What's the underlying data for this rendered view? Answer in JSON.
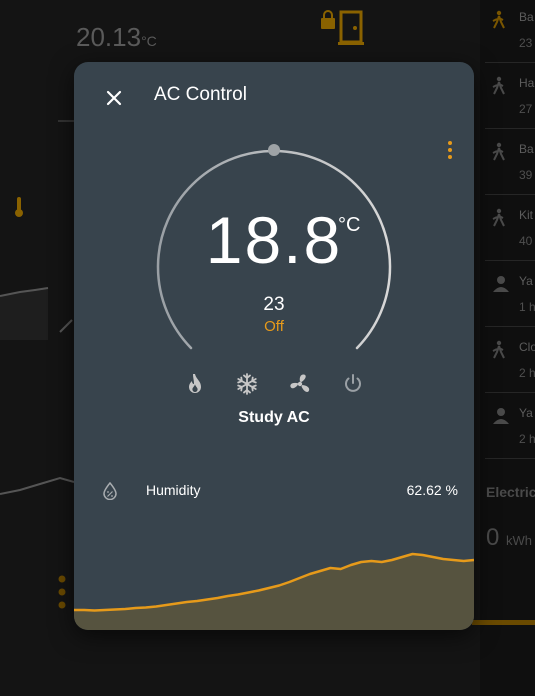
{
  "background": {
    "temperature": "20.13",
    "temperature_unit": "°C",
    "right_rows": [
      {
        "label": "Ba",
        "value": "23"
      },
      {
        "label": "Ha",
        "value": "27"
      },
      {
        "label": "Ba",
        "value": "39"
      },
      {
        "label": "Kit",
        "value": "40"
      },
      {
        "label": "Ya",
        "value": "1 h"
      },
      {
        "label": "Clo",
        "value": "2 h"
      },
      {
        "label": "Ya",
        "value": "2 h"
      }
    ],
    "electricity_label": "Electric",
    "energy_value": "0",
    "energy_unit": "kWh"
  },
  "dialog": {
    "title": "AC Control",
    "close_icon": "close-icon",
    "menu_icon": "dots-vertical-icon",
    "thermostat": {
      "target_temperature": "18.8",
      "unit": "°C",
      "current_temperature": "23",
      "mode_state": "Off",
      "entity_name": "Study AC",
      "setpoint_fraction": 0.5,
      "modes": [
        {
          "name": "heat",
          "icon": "flame-icon"
        },
        {
          "name": "cool",
          "icon": "snowflake-icon"
        },
        {
          "name": "fan",
          "icon": "fan-icon"
        },
        {
          "name": "off",
          "icon": "power-icon"
        }
      ]
    },
    "humidity": {
      "icon": "water-percent-icon",
      "label": "Humidity",
      "value": "62.62 %",
      "history": [
        40,
        40,
        39,
        40,
        41,
        42,
        44,
        45,
        47,
        50,
        53,
        56,
        58,
        61,
        64,
        68,
        71,
        75,
        79,
        84,
        89,
        96,
        104,
        112,
        118,
        124,
        122,
        130,
        136,
        138,
        136,
        140,
        146,
        152,
        150,
        146,
        142,
        140,
        138,
        140
      ]
    }
  },
  "colors": {
    "accent": "#e69a1a",
    "dialog_bg": "#38444d",
    "chart_fill": "#56533f"
  }
}
